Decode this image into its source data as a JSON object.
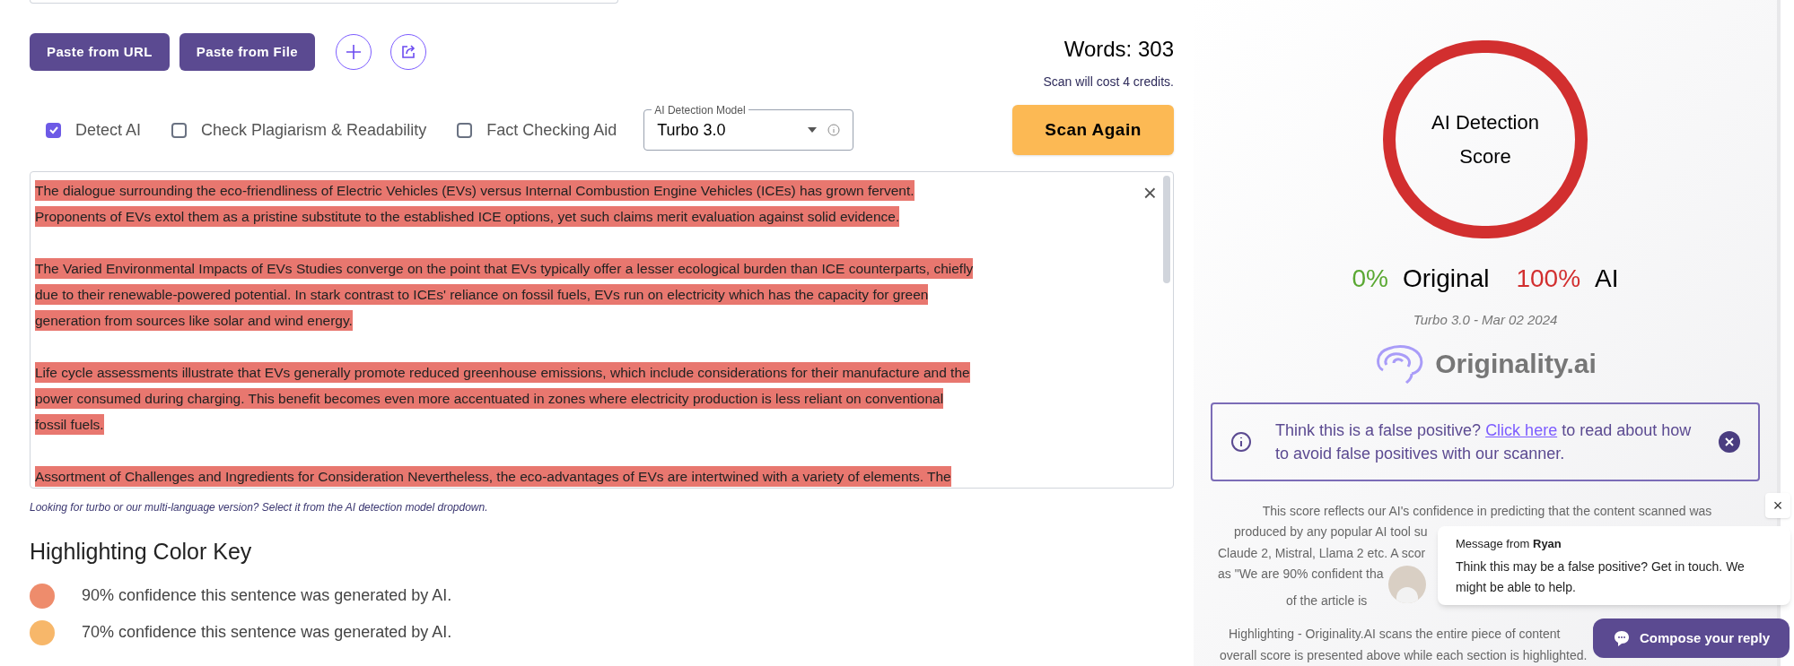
{
  "toolbar": {
    "buttons": [
      "Paste from URL",
      "Paste from File"
    ],
    "word_count": "Words: 303",
    "cost": "Scan will cost 4 credits."
  },
  "options": [
    {
      "label": "Detect AI",
      "checked": true
    },
    {
      "label": "Check Plagiarism & Readability",
      "checked": false
    },
    {
      "label": "Fact Checking Aid",
      "checked": false
    }
  ],
  "model_select": {
    "label": "AI Detection Model",
    "value": "Turbo 3.0"
  },
  "scan_button": "Scan Again",
  "editor": {
    "paragraphs": [
      [
        "The dialogue surrounding the eco-friendliness of Electric Vehicles (EVs) versus Internal Combustion Engine Vehicles (ICEs) has grown fervent.",
        "Proponents of EVs extol them as a pristine substitute to the established ICE options, yet such claims merit evaluation against solid evidence."
      ],
      [
        "The Varied Environmental Impacts of EVs Studies converge on the point that EVs typically offer a lesser ecological burden than ICE counterparts, chiefly",
        "due to their renewable-powered potential. In stark contrast to ICEs' reliance on fossil fuels, EVs run on electricity which has the capacity for green",
        "generation from sources like solar and wind energy."
      ],
      [
        "Life cycle assessments illustrate that EVs generally promote reduced greenhouse emissions, which include considerations for their manufacture and the",
        "power consumed during charging. This benefit becomes even more accentuated in zones where electricity production is less reliant on conventional",
        "fossil fuels."
      ],
      [
        "Assortment of Challenges and Ingredients for Consideration Nevertheless, the eco-advantages of EVs are intertwined with a variety of elements. The"
      ]
    ],
    "close": "×"
  },
  "hint": "Looking for turbo or our multi-language version? Select it from the AI detection model dropdown.",
  "color_key": {
    "title": "Highlighting Color Key",
    "items": [
      {
        "label": "90% confidence this sentence was generated by AI.",
        "color": "#ee8c6c"
      },
      {
        "label": "70% confidence this sentence was generated by AI.",
        "color": "#f7b76a"
      }
    ]
  },
  "score": {
    "title_lines": [
      "AI Detection",
      "Score"
    ],
    "original_pct": "0%",
    "original_label": "Original",
    "ai_pct": "100%",
    "ai_label": "AI",
    "model_date": "Turbo 3.0 - Mar 02 2024",
    "brand": "Originality.ai"
  },
  "notice": {
    "text_before": "Think this is a false positive?",
    "link": "Click here",
    "text_after": "to read about how to avoid false positives with our scanner."
  },
  "explanation_lines": [
    {
      "text": "This score reflects our AI's confidence in predicting that the content scanned was"
    },
    {
      "text": "produced by any popular AI tool su"
    },
    {
      "text": "Claude 2, Mistral, Llama 2 etc. A scor"
    },
    {
      "text": "as \"We are 90% confident tha"
    },
    {
      "text": "of the article is"
    }
  ],
  "highlighting_lines": [
    {
      "text": "Highlighting - Originality.AI scans the entire piece of content"
    },
    {
      "text": "overall score is presented above while each section is highlighted."
    }
  ],
  "chat": {
    "from_label": "Message from",
    "from_name": "Ryan",
    "message": "Think this may be a false positive? Get in touch. We might be able to help.",
    "close": "×",
    "compose": "Compose your reply"
  }
}
